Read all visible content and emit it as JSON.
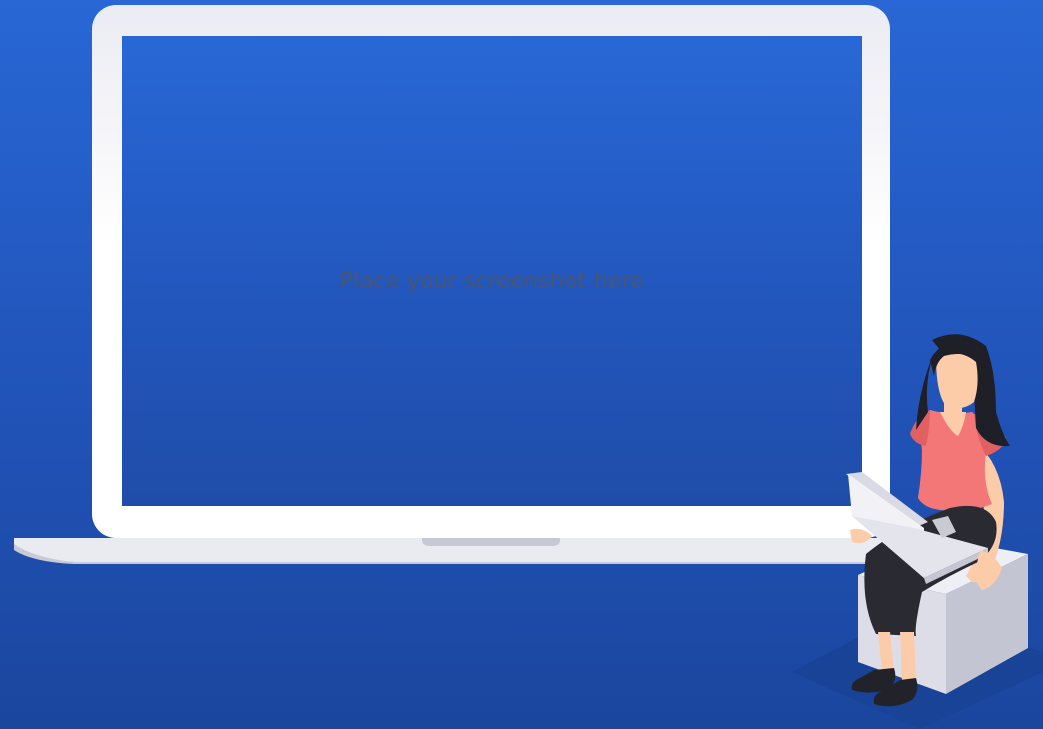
{
  "screen": {
    "placeholder": "Place your screenshot here"
  },
  "colors": {
    "background": "#2153b8",
    "screen": "#2358c0",
    "laptop_frame": "#ffffff",
    "placeholder_text": "#4a5570",
    "shirt": "#f47777",
    "skirt": "#2a2a33",
    "skin": "#fccca8",
    "hair": "#1f1f28",
    "box": "#dcdde6"
  },
  "icons": [
    "laptop-illustration",
    "woman-with-laptop-illustration",
    "box-seat-illustration"
  ]
}
